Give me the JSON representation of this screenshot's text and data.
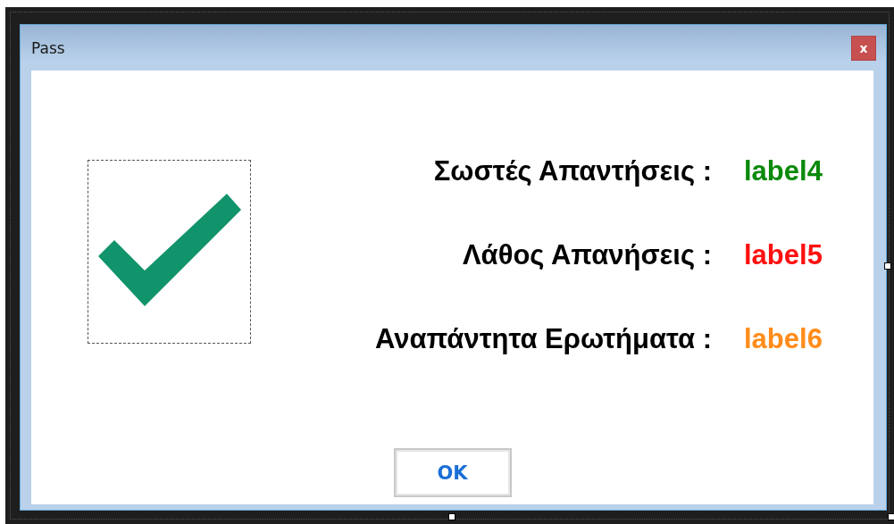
{
  "window": {
    "title": "Pass",
    "close_button": "x"
  },
  "stats": [
    {
      "label": "Σωστές Απαντήσεις :",
      "value": "label4",
      "color": "#0a8a0a"
    },
    {
      "label": "Λάθος Απανήσεις :",
      "value": "label5",
      "color": "#ff1010"
    },
    {
      "label": "Αναπάντητα Ερωτήματα :",
      "value": "label6",
      "color": "#ff8c1a"
    }
  ],
  "buttons": [
    "OK"
  ]
}
